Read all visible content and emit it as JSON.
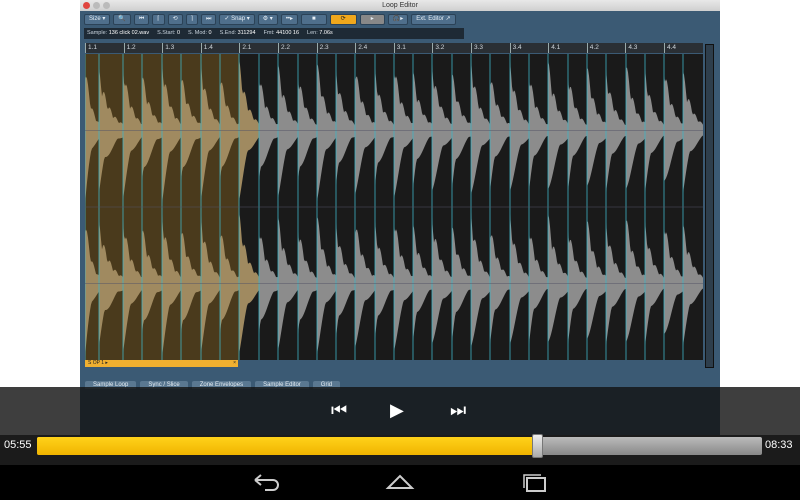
{
  "window": {
    "title": "Loop Editor"
  },
  "toolbar": {
    "size": "Size ▾",
    "zoom": "🔍",
    "start": "⏮",
    "marker_in": "⌈",
    "loop": "⟲",
    "marker_out": "⌉",
    "end": "⏭",
    "snap": "✓ Snap ▾",
    "settings": "⚙ ▾",
    "step": "••▸",
    "stop": "■",
    "loop_play": "⟳",
    "play": "▸",
    "audition": "🎧▸",
    "ext_editor": "Ext. Editor ↗"
  },
  "info": {
    "sample_label": "Sample:",
    "sample": "136 click 02.wav",
    "sstart_label": "S.Start:",
    "sstart": "0",
    "smod_label": "S. Mod:",
    "smod": "0",
    "send_label": "S.End:",
    "send": "311294",
    "fmt_label": "Fmt:",
    "fmt": "44100",
    "bits": "16",
    "len_label": "Len:",
    "len": "7.06s"
  },
  "ruler": [
    "1.1",
    "1.2",
    "1.3",
    "1.4",
    "2.1",
    "2.2",
    "2.3",
    "2.4",
    "3.1",
    "3.2",
    "3.3",
    "3.4",
    "4.1",
    "4.2",
    "4.3",
    "4.4"
  ],
  "loop_region": {
    "label": "S OP 1 ▸",
    "close": "×",
    "fraction": 0.25,
    "color": "#f0b030"
  },
  "bottom_tabs": [
    "Sample Loop",
    "Sync / Slice",
    "Zone Envelopes",
    "Sample Editor",
    "Grid"
  ],
  "player": {
    "elapsed": "05:55",
    "total": "08:33",
    "progress_percent": 69,
    "accent": "#f5c000",
    "prev": "⏮",
    "play": "▶",
    "next": "⏭"
  },
  "navbar": {
    "back": "back-icon",
    "home": "home-icon",
    "recents": "recents-icon"
  }
}
